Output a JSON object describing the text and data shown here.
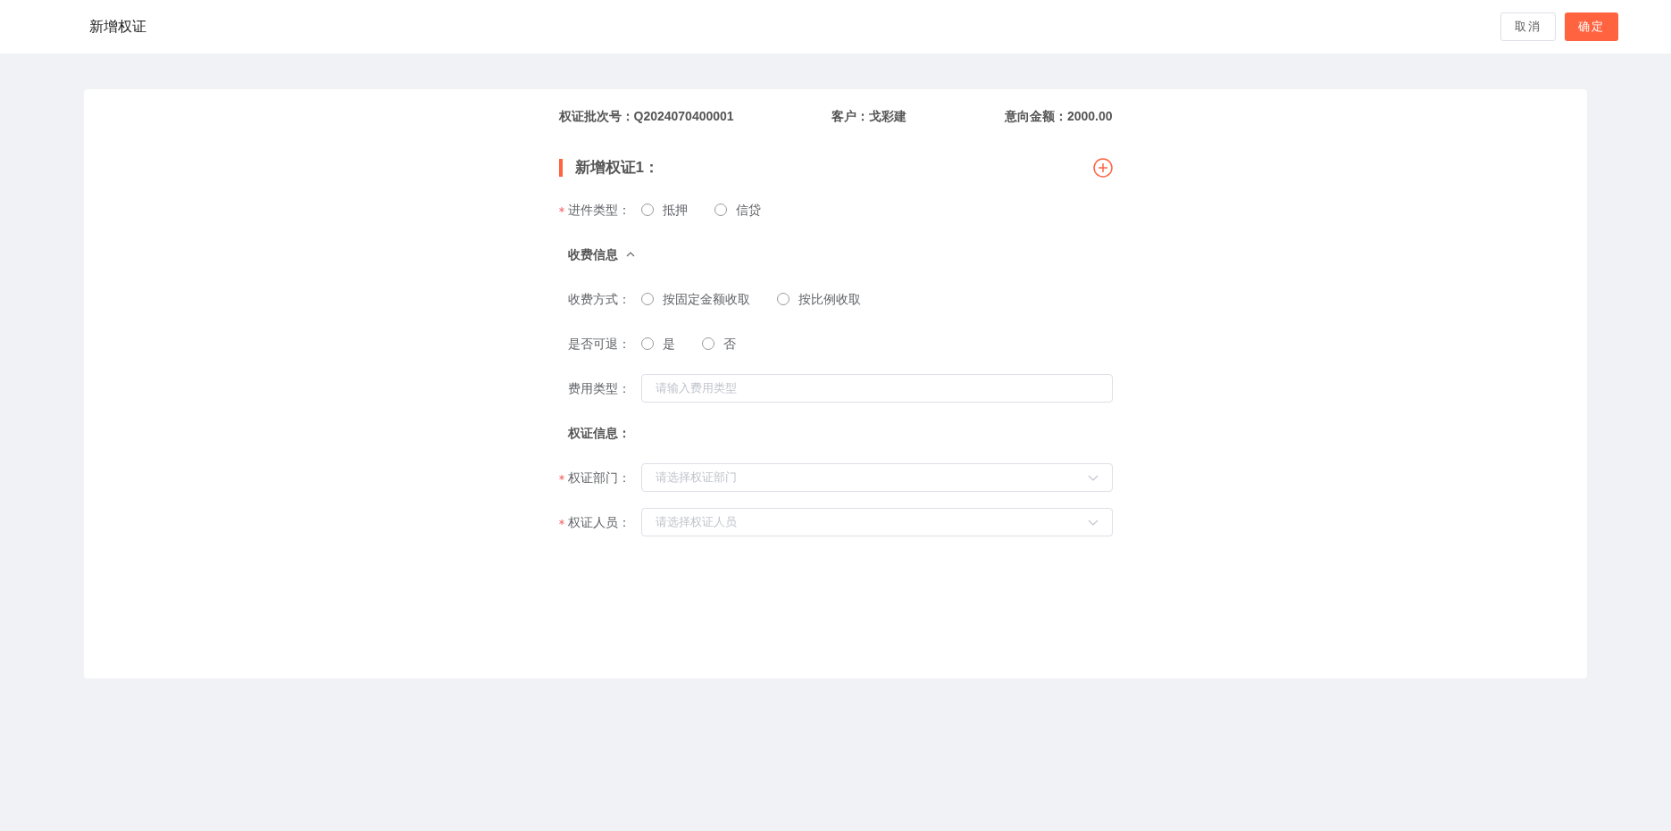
{
  "header": {
    "title": "新增权证",
    "buttons": [
      {
        "label": "取消",
        "kind": "default"
      },
      {
        "label": "确定",
        "kind": "primary"
      }
    ]
  },
  "summary": [
    {
      "label": "权证批次号：",
      "value": "Q2024070400001"
    },
    {
      "label": "客户：",
      "value": "戈彩建"
    },
    {
      "label": "意向金额：",
      "value": "2000.00"
    }
  ],
  "section": {
    "title": "新增权证1："
  },
  "fields": [
    {
      "kind": "radio",
      "label": "进件类型：",
      "required": true,
      "options": [
        {
          "label": "抵押",
          "selected": false
        },
        {
          "label": "信贷",
          "selected": false
        }
      ]
    },
    {
      "kind": "heading",
      "label": "收费信息",
      "expanded": true
    },
    {
      "kind": "radio",
      "label": "收费方式：",
      "required": false,
      "options": [
        {
          "label": "按固定金额收取",
          "selected": false
        },
        {
          "label": "按比例收取",
          "selected": false
        }
      ]
    },
    {
      "kind": "radio",
      "label": "是否可退：",
      "required": false,
      "options": [
        {
          "label": "是",
          "selected": false
        },
        {
          "label": "否",
          "selected": false
        }
      ]
    },
    {
      "kind": "input",
      "label": "费用类型：",
      "required": false,
      "placeholder": "请输入费用类型"
    },
    {
      "kind": "heading",
      "label": "权证信息："
    },
    {
      "kind": "select",
      "label": "权证部门：",
      "required": true,
      "placeholder": "请选择权证部门"
    },
    {
      "kind": "select",
      "label": "权证人员：",
      "required": true,
      "placeholder": "请选择权证人员"
    }
  ]
}
